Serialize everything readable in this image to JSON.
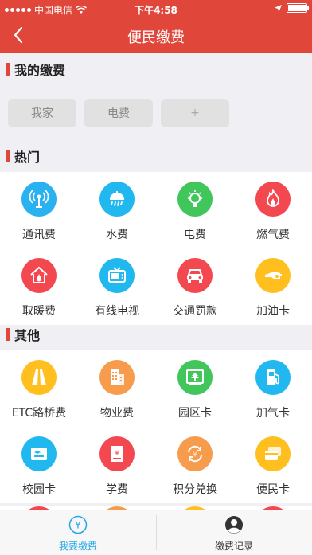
{
  "status_bar": {
    "carrier": "中国电信",
    "time": "下午4:58"
  },
  "nav": {
    "title": "便民缴费"
  },
  "my_payments": {
    "title": "我的缴费",
    "items": [
      "我家",
      "电费",
      "+"
    ]
  },
  "hot": {
    "title": "热门",
    "items": [
      {
        "label": "通讯费",
        "icon": "antenna-icon",
        "color": "#2ab1f0"
      },
      {
        "label": "水费",
        "icon": "shower-icon",
        "color": "#20b8ef"
      },
      {
        "label": "电费",
        "icon": "lightbulb-icon",
        "color": "#41c65b"
      },
      {
        "label": "燃气费",
        "icon": "flame-icon",
        "color": "#f3484f"
      },
      {
        "label": "取暖费",
        "icon": "house-fire-icon",
        "color": "#f3484f"
      },
      {
        "label": "有线电视",
        "icon": "tv-icon",
        "color": "#20b8ef"
      },
      {
        "label": "交通罚款",
        "icon": "car-icon",
        "color": "#f3484f"
      },
      {
        "label": "加油卡",
        "icon": "fuel-nozzle-icon",
        "color": "#ffc01f"
      }
    ]
  },
  "other": {
    "title": "其他",
    "items": [
      {
        "label": "ETC路桥费",
        "icon": "road-icon",
        "color": "#ffc01f"
      },
      {
        "label": "物业费",
        "icon": "building-icon",
        "color": "#f79b4c"
      },
      {
        "label": "园区卡",
        "icon": "park-card-icon",
        "color": "#41c65b"
      },
      {
        "label": "加气卡",
        "icon": "gas-pump-icon",
        "color": "#20b8ef"
      },
      {
        "label": "校园卡",
        "icon": "campus-card-icon",
        "color": "#20b8ef"
      },
      {
        "label": "学费",
        "icon": "tuition-book-icon",
        "color": "#f3484f"
      },
      {
        "label": "积分兑换",
        "icon": "points-exchange-icon",
        "color": "#f79b4c"
      },
      {
        "label": "便民卡",
        "icon": "convenience-card-icon",
        "color": "#ffc01f"
      }
    ]
  },
  "tabs": [
    {
      "label": "我要缴费",
      "icon": "yen-circle-icon",
      "active": true,
      "color": "#20a7e8"
    },
    {
      "label": "缴费记录",
      "icon": "user-avatar-icon",
      "active": false,
      "color": "#333333"
    }
  ],
  "colors": {
    "brand_red": "#e0463a",
    "active_tab": "#20a7e8"
  }
}
